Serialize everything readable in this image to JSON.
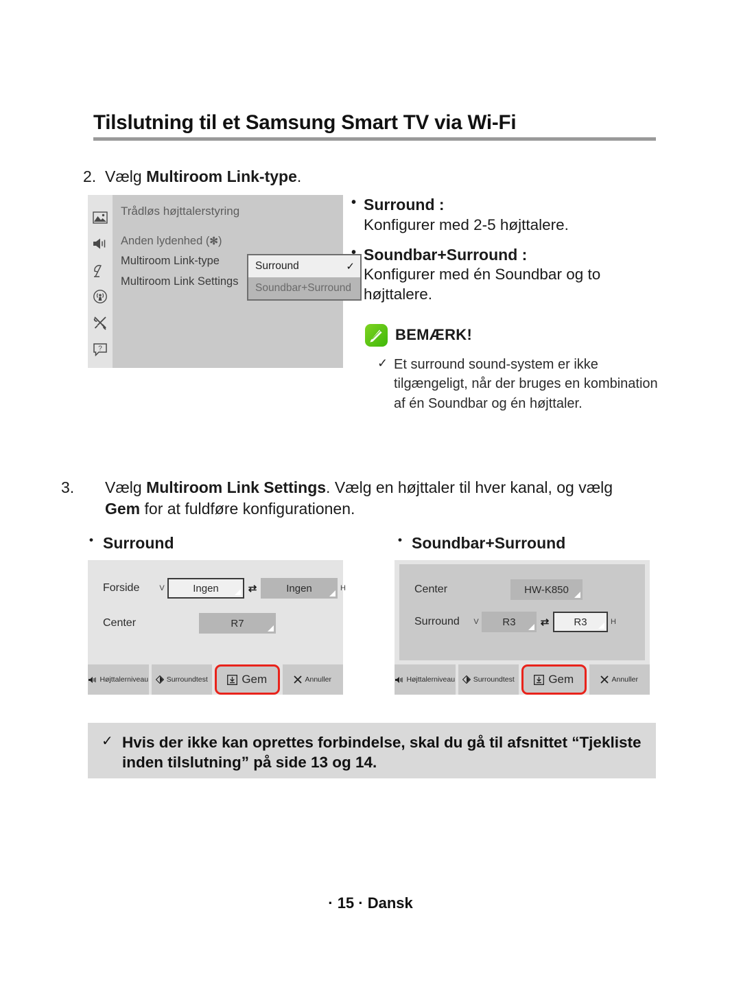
{
  "header": {
    "title": "Tilslutning til et Samsung Smart TV via Wi-Fi"
  },
  "step2": {
    "number": "2.",
    "text_before": "Vælg ",
    "bold": "Multiroom Link-type",
    "text_after": "."
  },
  "tv_menu": {
    "sidebar_icons": [
      "picture-icon",
      "sound-icon",
      "broadcasting-icon",
      "network-icon",
      "system-tools-icon",
      "support-icon"
    ],
    "title": "Trådløs højttalerstyring",
    "rows": [
      "Anden lydenhed (",
      "Multiroom Link-type",
      "Multiroom Link Settings"
    ],
    "bluetooth_glyph": "✻",
    "row_close": ")",
    "dropdown": {
      "selected": "Surround",
      "check": "✓",
      "other": "Soundbar+Surround"
    }
  },
  "options": {
    "surround_head": "Surround :",
    "surround_desc": "Konfigurer med 2-5 højttalere.",
    "soundbar_head": "Soundbar+Surround :",
    "soundbar_desc": "Konfigurer med én Soundbar og to højttalere."
  },
  "note": {
    "badge": "note-pencil-icon",
    "title": "BEMÆRK!",
    "check": "✓",
    "item": "Et surround sound-system er ikke tilgængeligt, når der bruges en kombination af én Soundbar og én højttaler."
  },
  "step3": {
    "number": "3.",
    "line1_before": "Vælg ",
    "line1_bold": "Multiroom Link Settings",
    "line1_after": ". Vælg en højttaler til hver kanal, og vælg",
    "line2_bold": "Gem",
    "line2_after": " for at fuldføre konfigurationen."
  },
  "subheads": {
    "left": "Surround",
    "right": "Soundbar+Surround"
  },
  "panel_left": {
    "rows": [
      {
        "label": "Forside",
        "left_marker": "V",
        "left_value": "Ingen",
        "swap": "⇄",
        "right_value": "Ingen",
        "right_marker": "H"
      },
      {
        "label": "Center",
        "value": "R7"
      }
    ],
    "buttons": [
      {
        "icon": "speaker-level-icon",
        "label": "Højttalerniveau"
      },
      {
        "icon": "surround-test-icon",
        "label": "Surroundtest"
      },
      {
        "icon": "save-icon",
        "label": "Gem"
      },
      {
        "icon": "cancel-x-icon",
        "label": "Annuller"
      }
    ]
  },
  "panel_right": {
    "rows": [
      {
        "label": "Center",
        "value": "HW-K850"
      },
      {
        "label": "Surround",
        "left_marker": "V",
        "left_value": "R3",
        "swap": "⇄",
        "right_value": "R3",
        "right_marker": "H"
      }
    ],
    "buttons": [
      {
        "icon": "speaker-level-icon",
        "label": "Højttalerniveau"
      },
      {
        "icon": "surround-test-icon",
        "label": "Surroundtest"
      },
      {
        "icon": "save-icon",
        "label": "Gem"
      },
      {
        "icon": "cancel-x-icon",
        "label": "Annuller"
      }
    ]
  },
  "tip": {
    "check": "✓",
    "text": "Hvis der ikke kan oprettes forbindelse, skal du gå til afsnittet “Tjekliste inden tilslutning” på side 13 og 14."
  },
  "footer": {
    "text": "· 15 · Dansk"
  },
  "colors": {
    "accent_red": "#e8231b",
    "note_green": "#5fc312",
    "panel_bg": "#e4e4e4",
    "panel_inner": "#c9c9c9",
    "select_bg": "#b6b6b6"
  }
}
